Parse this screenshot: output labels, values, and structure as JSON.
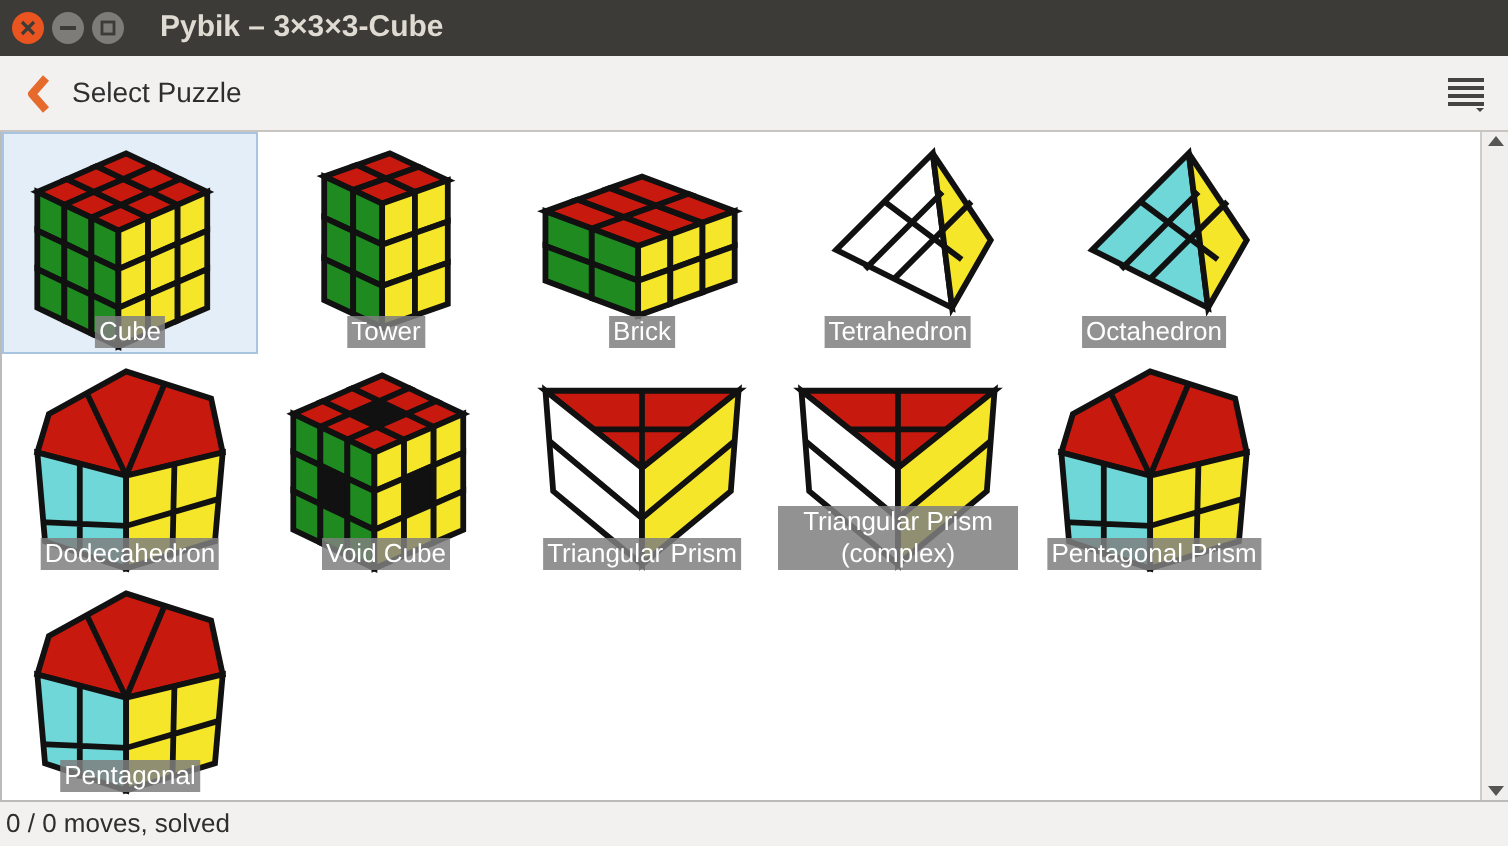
{
  "window": {
    "title": "Pybik – 3×3×3-Cube"
  },
  "toolbar": {
    "title": "Select Puzzle"
  },
  "puzzles": [
    {
      "label": "Cube",
      "kind": "cube",
      "selected": true
    },
    {
      "label": "Tower",
      "kind": "tower",
      "selected": false
    },
    {
      "label": "Brick",
      "kind": "brick",
      "selected": false
    },
    {
      "label": "Tetrahedron",
      "kind": "tetra",
      "selected": false
    },
    {
      "label": "Octahedron",
      "kind": "octa",
      "selected": false
    },
    {
      "label": "Dodecahedron",
      "kind": "dodeca",
      "selected": false
    },
    {
      "label": "Void Cube",
      "kind": "void",
      "selected": false
    },
    {
      "label": "Triangular Prism",
      "kind": "triprism",
      "selected": false
    },
    {
      "label": "Triangular Prism (complex)",
      "kind": "triprism",
      "selected": false
    },
    {
      "label": "Pentagonal Prism",
      "kind": "pentaprism",
      "selected": false
    },
    {
      "label": "Pentagonal",
      "kind": "pentaprism",
      "selected": false
    }
  ],
  "status_bar": {
    "text": "0 / 0 moves, solved"
  }
}
